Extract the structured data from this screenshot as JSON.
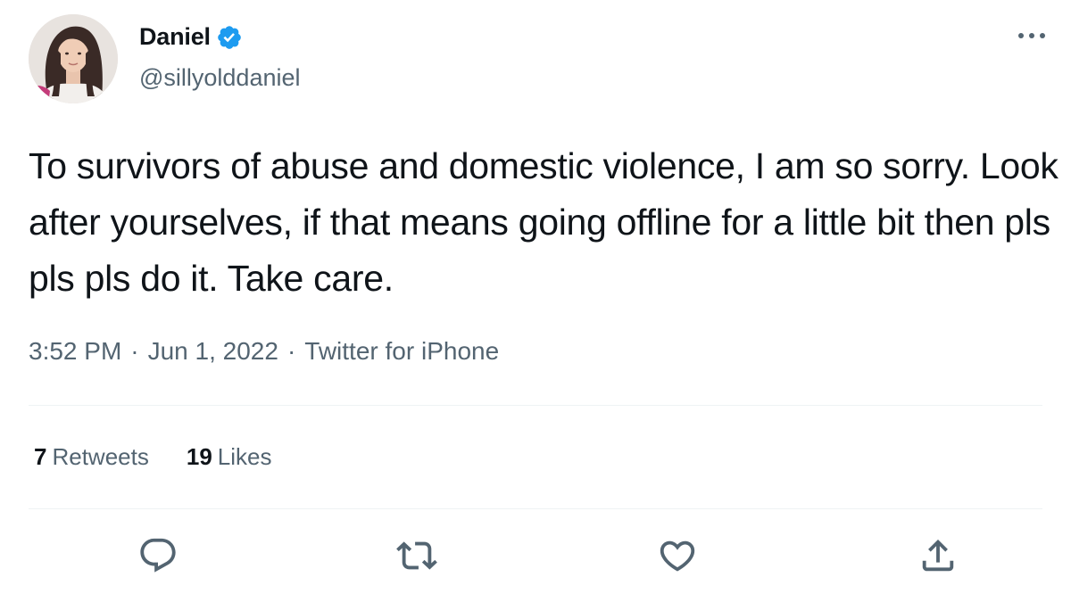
{
  "author": {
    "display_name": "Daniel",
    "handle": "@sillyolddaniel",
    "verified_icon": "verified-badge-icon",
    "avatar_icon": "avatar"
  },
  "tweet": {
    "text": "To survivors of abuse and domestic violence, I am so sorry. Look after yourselves, if that means going offline for a little bit then pls pls pls do it. Take care.",
    "time": "3:52 PM",
    "separator": "·",
    "date": "Jun 1, 2022",
    "source": "Twitter for iPhone"
  },
  "stats": {
    "retweets_count": "7",
    "retweets_label": "Retweets",
    "likes_count": "19",
    "likes_label": "Likes"
  },
  "actions": {
    "reply_icon": "reply-icon",
    "retweet_icon": "retweet-icon",
    "like_icon": "heart-icon",
    "share_icon": "share-icon",
    "more_icon": "more-icon"
  },
  "colors": {
    "text_primary": "#0f1419",
    "text_secondary": "#536471",
    "verified_blue": "#1d9bf0",
    "divider": "#eff3f4"
  }
}
